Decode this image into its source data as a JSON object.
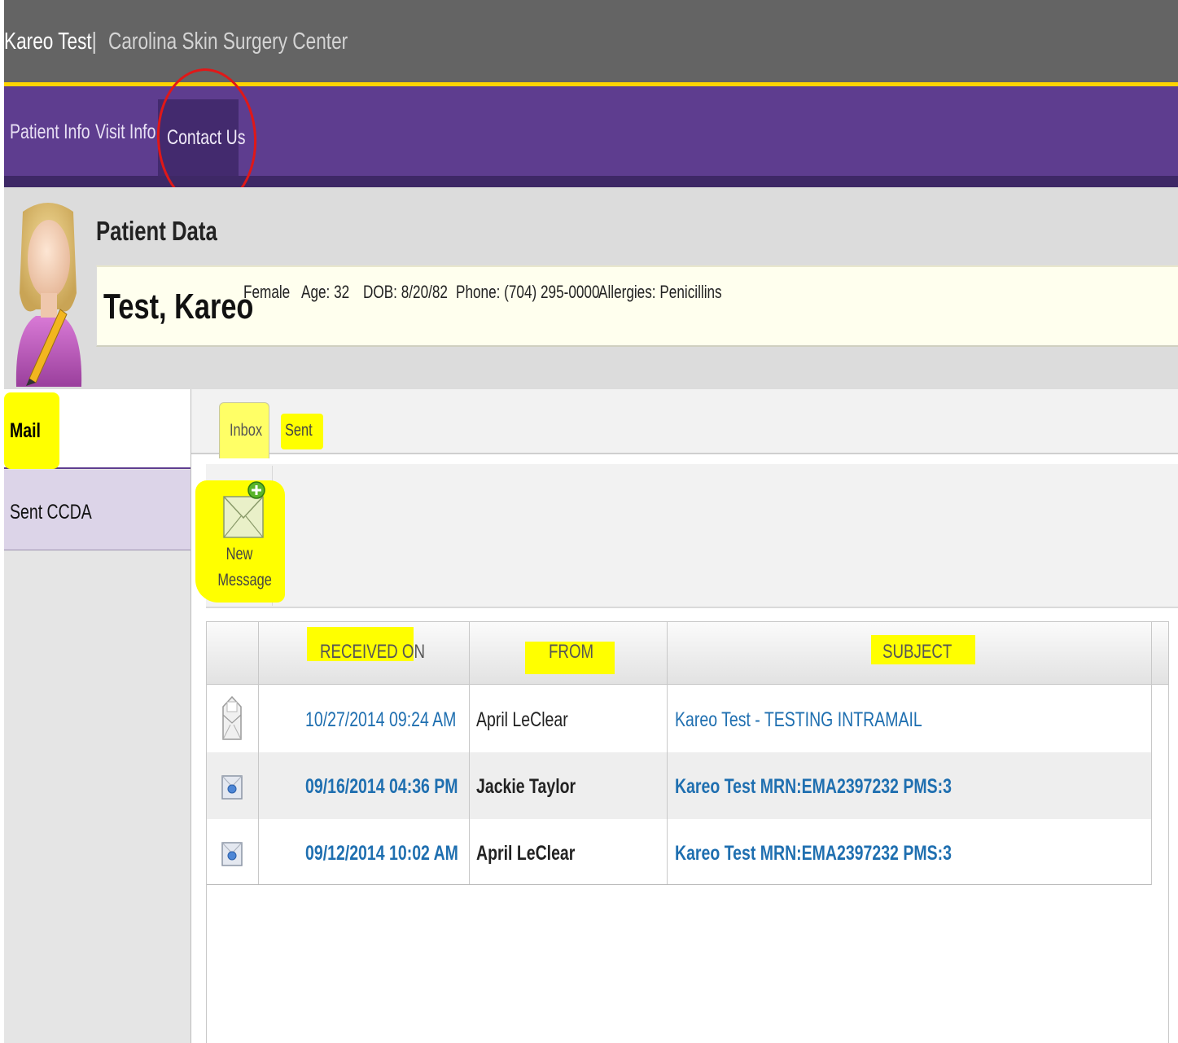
{
  "header": {
    "user_name": "Kareo Test",
    "separator": "|",
    "practice_name": "Carolina Skin Surgery Center"
  },
  "nav": {
    "items": [
      {
        "label": "Patient Info"
      },
      {
        "label": "Visit Info"
      },
      {
        "label": "Contact Us",
        "active": true
      }
    ]
  },
  "patient": {
    "heading": "Patient Data",
    "name": "Test, Kareo",
    "gender": "Female",
    "age": "Age: 32",
    "dob": "DOB: 8/20/82",
    "phone": "Phone: (704) 295-0000",
    "allergies": "Allergies: Penicillins",
    "avatar_icon": "female-patient-avatar-icon"
  },
  "sidebar": {
    "items": [
      {
        "label": "Mail",
        "active": true
      },
      {
        "label": "Sent CCDA"
      }
    ]
  },
  "mail": {
    "tabs": [
      {
        "label": "Inbox",
        "active": true
      },
      {
        "label": "Sent"
      }
    ],
    "new_message": {
      "line1": "New",
      "line2": "Message",
      "icon": "new-message-envelope-icon"
    },
    "columns": [
      "RECEIVED ON",
      "FROM",
      "SUBJECT"
    ],
    "messages": [
      {
        "received": "10/27/2014 09:24 AM",
        "from": "April LeClear",
        "subject": "Kareo Test - TESTING INTRAMAIL",
        "read": true
      },
      {
        "received": "09/16/2014 04:36 PM",
        "from": "Jackie Taylor",
        "subject": "Kareo Test MRN:EMA2397232 PMS:3",
        "read": false
      },
      {
        "received": "09/12/2014 10:02 AM",
        "from": "April LeClear",
        "subject": "Kareo Test MRN:EMA2397232 PMS:3",
        "read": false
      }
    ]
  },
  "colors": {
    "top_bar": "#646464",
    "accent_gold": "#ffd400",
    "nav_purple": "#5e3d8f",
    "highlight": "#ffff00",
    "annotation_red": "#e01818",
    "link_blue": "#1f6fb0"
  }
}
